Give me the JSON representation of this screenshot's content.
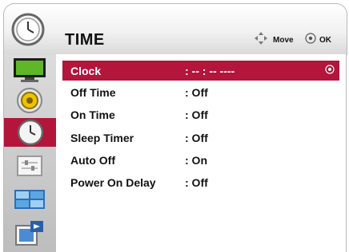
{
  "header": {
    "title": "TIME",
    "move_label": "Move",
    "ok_label": "OK",
    "colors": {
      "accent": "#b3153b"
    }
  },
  "sidebar": {
    "items": [
      {
        "icon": "monitor-icon"
      },
      {
        "icon": "speaker-icon"
      },
      {
        "icon": "clock-icon",
        "active": true
      },
      {
        "icon": "options-icon"
      },
      {
        "icon": "display-icon"
      },
      {
        "icon": "input-icon"
      }
    ]
  },
  "menu": {
    "rows": [
      {
        "label": "Clock",
        "value": ": -- : -- ----",
        "selected": true
      },
      {
        "label": "Off Time",
        "value": ": Off"
      },
      {
        "label": "On Time",
        "value": ": Off"
      },
      {
        "label": "Sleep Timer",
        "value": ": Off"
      },
      {
        "label": "Auto Off",
        "value": ": On"
      },
      {
        "label": "Power On Delay",
        "value": ": Off"
      }
    ]
  }
}
